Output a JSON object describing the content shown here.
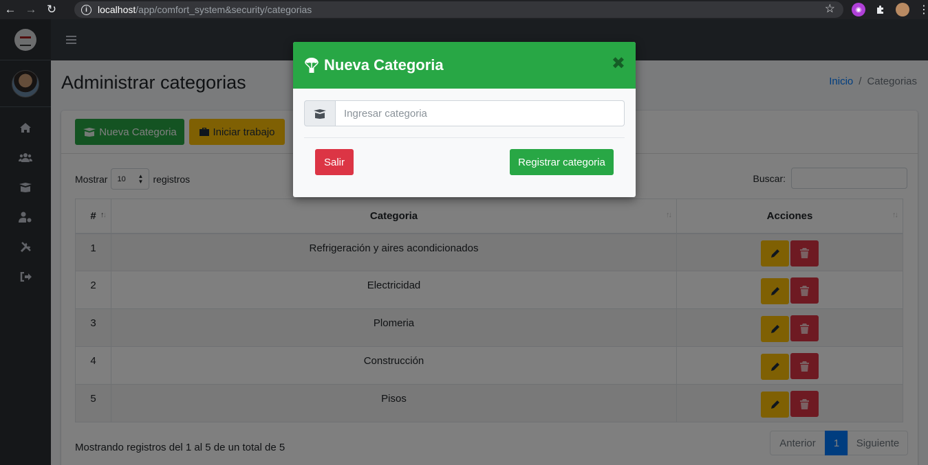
{
  "browser": {
    "url_host": "localhost",
    "url_path": "/app/comfort_system&security/categorias",
    "info_glyph": "i"
  },
  "header": {
    "title": "Administrar categorias",
    "breadcrumb": {
      "home": "Inicio",
      "separator": "/",
      "current": "Categorias"
    }
  },
  "toolbar": {
    "new_label": "Nueva Categoria",
    "work_label": "Iniciar trabajo"
  },
  "table_controls": {
    "show_label": "Mostrar",
    "page_length": "10",
    "records_label": "registros",
    "search_label": "Buscar:"
  },
  "table": {
    "columns": [
      "#",
      "Categoria",
      "Acciones"
    ],
    "rows": [
      {
        "id": "1",
        "name": "Refrigeración y aires acondicionados"
      },
      {
        "id": "2",
        "name": "Electricidad"
      },
      {
        "id": "3",
        "name": "Plomeria"
      },
      {
        "id": "4",
        "name": "Construcción"
      },
      {
        "id": "5",
        "name": "Pisos"
      }
    ]
  },
  "footer": {
    "info": "Mostrando registros del 1 al 5 de un total de 5",
    "prev": "Anterior",
    "current_page": "1",
    "next": "Siguiente"
  },
  "modal": {
    "title": "Nueva Categoria",
    "input_placeholder": "Ingresar categoria",
    "cancel_label": "Salir",
    "submit_label": "Registrar categoria"
  },
  "colors": {
    "success": "#28a745",
    "warning": "#ffc107",
    "danger": "#dc3545",
    "primary": "#007bff",
    "sidebar": "#343a40"
  },
  "icons": {
    "modal_title": "parachute-box-icon",
    "input_addon": "box-open-icon",
    "edit": "pencil-icon",
    "delete": "trash-icon"
  }
}
